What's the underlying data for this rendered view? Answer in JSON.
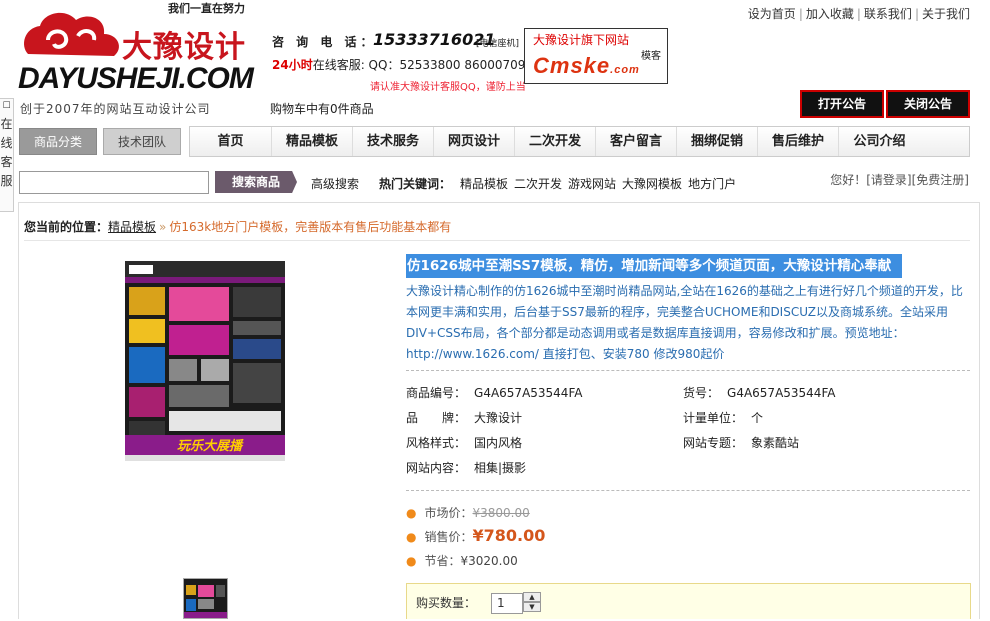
{
  "header": {
    "slogan": "我们一直在努力",
    "logo_cn": "大豫设计",
    "logo_en": "DAYUSHEJI.COM",
    "logo_sub": "创于2007年的网站互动设计公司",
    "consult_label": "咨 询 电 话：",
    "phone": "15333716021",
    "phone_note": "[电信座机]",
    "online_hours": "24小时",
    "online_label": "在线客服: QQ：52533800   860007099",
    "qq_note": "请认准大豫设计客服QQ，谨防上当",
    "cart_text": "购物车中有0件商品"
  },
  "partner": {
    "title": "大豫设计旗下网站",
    "logo": "Cmske",
    "logo_suffix": ".com",
    "right_text": "模客"
  },
  "top_links": [
    "设为首页",
    "加入收藏",
    "联系我们",
    "关于我们"
  ],
  "notice": {
    "open": "打开公告",
    "close": "关闭公告"
  },
  "side_tab": "在线客服",
  "side_tab_chars": [
    "在",
    "线",
    "客",
    "服"
  ],
  "nav": {
    "category_button": "商品分类",
    "team_button": "技术团队",
    "items": [
      "首页",
      "精品模板",
      "技术服务",
      "网页设计",
      "二次开发",
      "客户留言",
      "捆绑促销",
      "售后维护",
      "公司介绍"
    ]
  },
  "search": {
    "placeholder": "",
    "button": "搜索商品",
    "advanced": "高级搜索",
    "hot_label": "热门关键词：",
    "hot_keywords": [
      "精品模板",
      "二次开发",
      "游戏网站",
      "大豫网模板",
      "地方门户"
    ]
  },
  "login": {
    "greeting": "您好！",
    "login": "[请登录]",
    "register": "[免费注册]"
  },
  "breadcrumb": {
    "label": "您当前的位置：",
    "category": "精品模板",
    "arrow": "»",
    "current": "仿163k地方门户模板，完善版本有售后功能基本都有"
  },
  "product": {
    "title": "仿1626城中至潮SS7模板，精仿，增加新闻等多个频道页面，大豫设计精心奉献",
    "description": "大豫设计精心制作的仿1626城中至潮时尚精品网站,全站在1626的基础之上有进行好几个频道的开发，比本网更丰满和实用，后台基于SS7最新的程序，完美整合UCHOME和DISCUZ以及商城系统。全站采用DIV+CSS布局，各个部分都是动态调用或者是数据库直接调用，容易修改和扩展。预览地址：http://www.1626.com/ 直接打包、安装780 修改980起价",
    "attributes": [
      {
        "label": "商品编号：",
        "value": "G4A657A53544FA"
      },
      {
        "label": "货号：",
        "value": "G4A657A53544FA"
      },
      {
        "label": "品　　牌：",
        "value": "大豫设计"
      },
      {
        "label": "计量单位：",
        "value": "个"
      },
      {
        "label": "风格样式：",
        "value": "国内风格"
      },
      {
        "label": "网站专题：",
        "value": "象素酷站"
      },
      {
        "label": "网站内容：",
        "value": "相集|摄影"
      }
    ],
    "market_price_label": "市场价：",
    "market_price": "¥3800.00",
    "sale_price_label": "销售价：",
    "sale_price": "¥780.00",
    "save_label": "节省：",
    "save_price": "¥3020.00",
    "qty_label": "购买数量：",
    "qty_value": "1",
    "image_text": "玩乐大展播"
  },
  "colors": {
    "accent_red": "#c8151d",
    "title_bg": "#3d8ee0",
    "price": "#d4561b",
    "link_blue": "#2a6db0"
  }
}
